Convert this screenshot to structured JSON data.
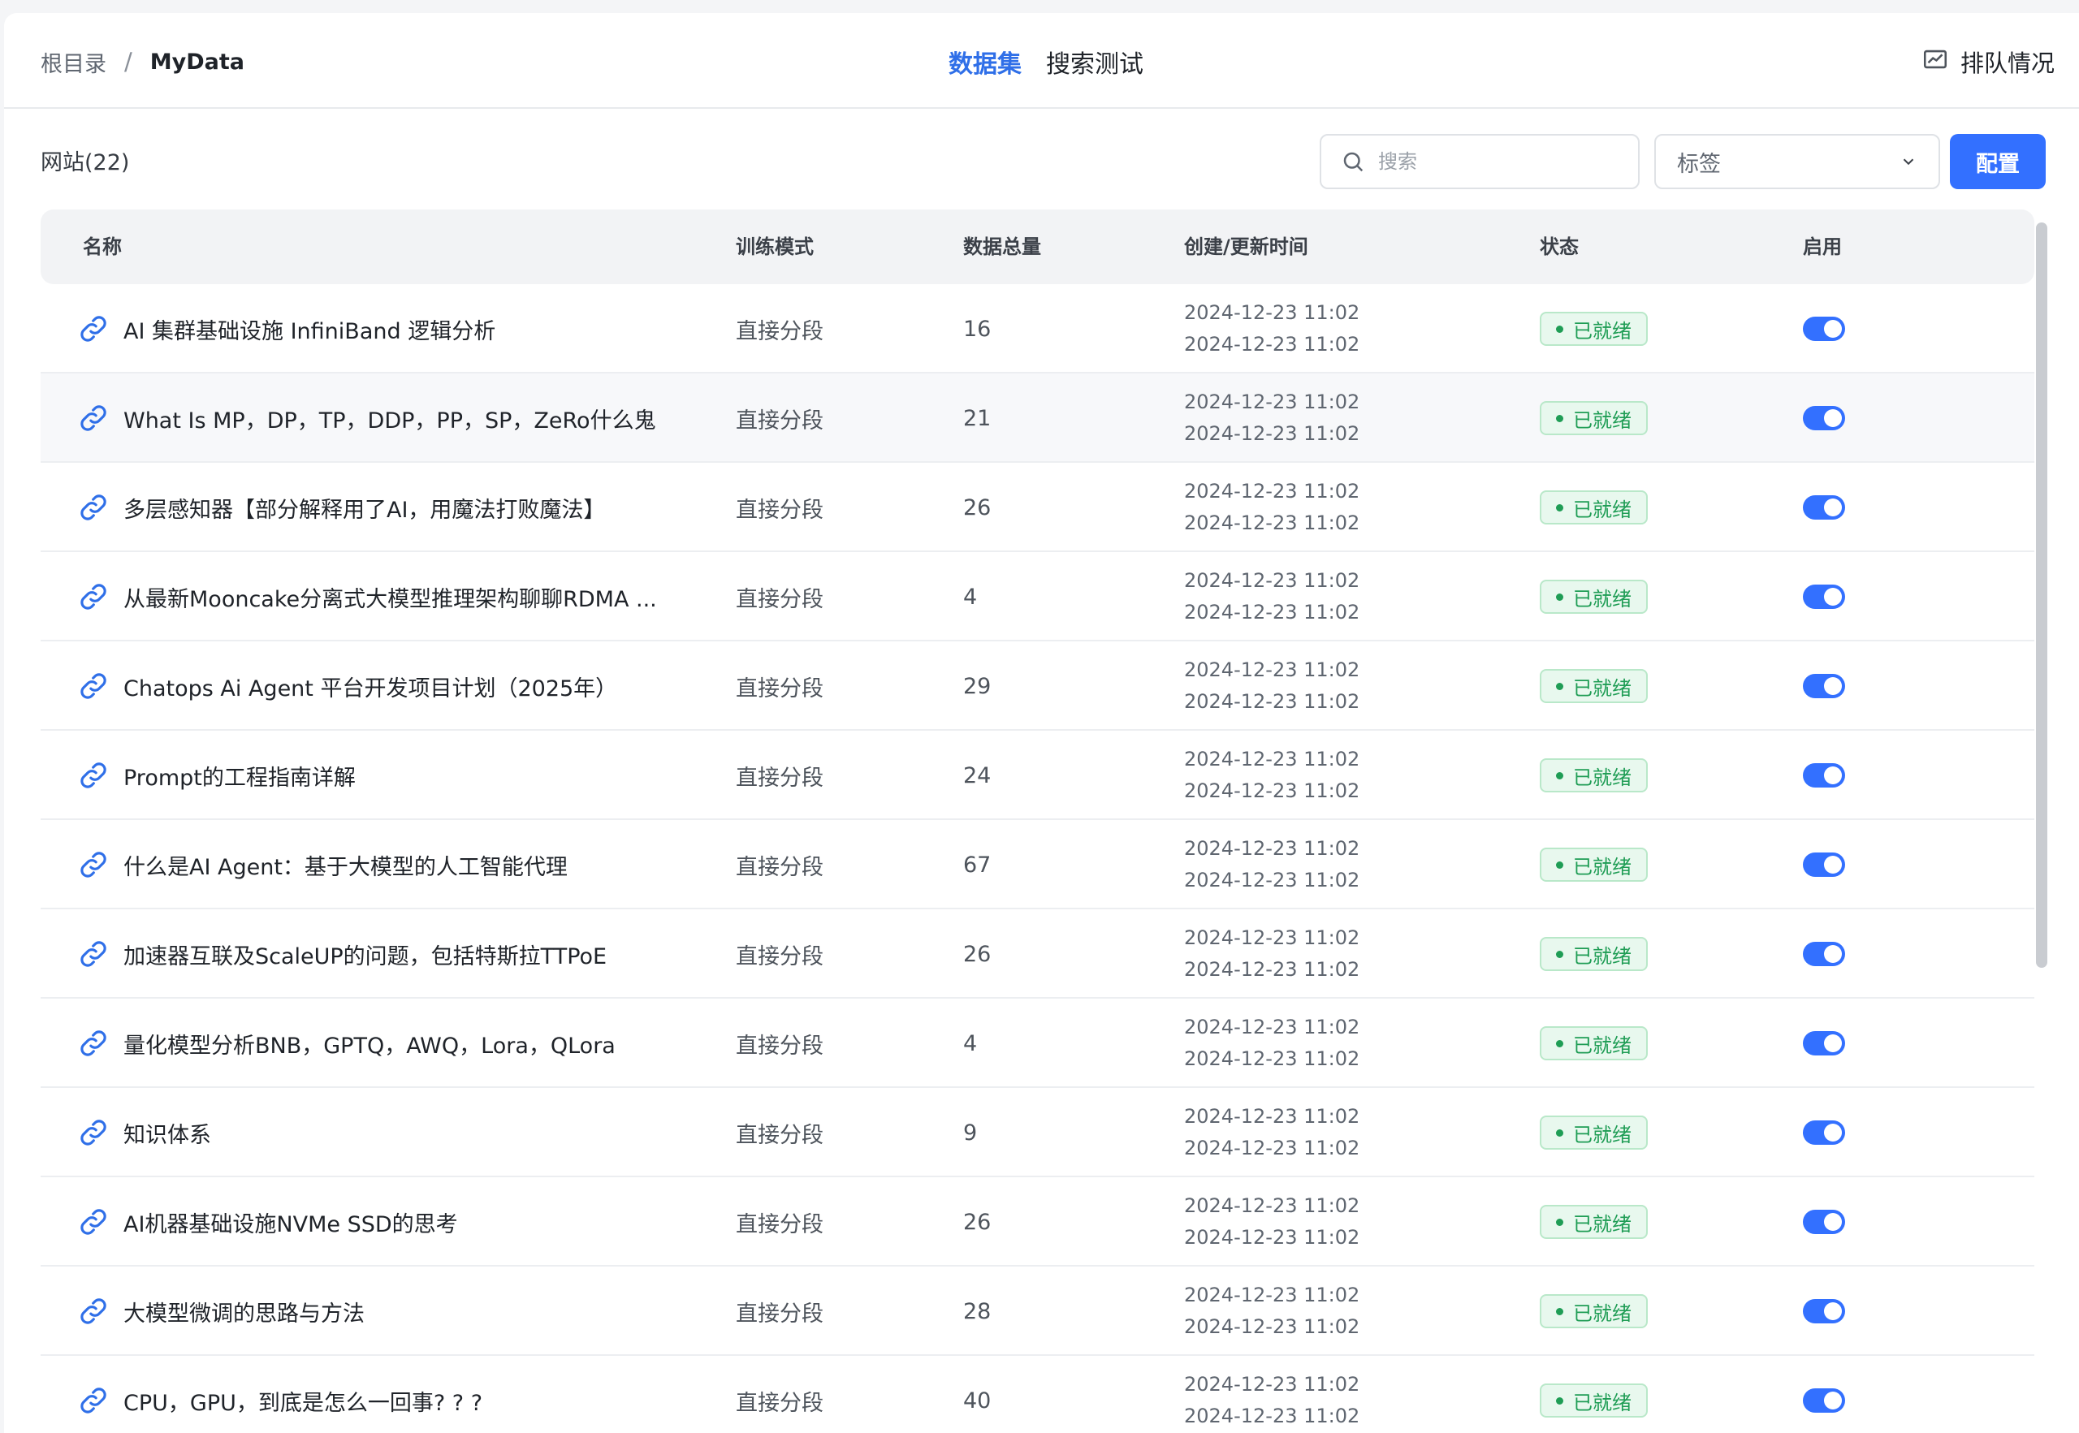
{
  "breadcrumb": {
    "root": "根目录",
    "separator": "/",
    "current": "MyData"
  },
  "tabs": [
    {
      "label": "数据集",
      "active": true
    },
    {
      "label": "搜索测试",
      "active": false
    }
  ],
  "queue": {
    "label": "排队情况",
    "icon": "queue-chart-icon"
  },
  "toolbar": {
    "count_label": "网站(22)",
    "search_placeholder": "搜索",
    "tag_select_label": "标签",
    "config_button": "配置"
  },
  "table": {
    "columns": [
      "名称",
      "训练模式",
      "数据总量",
      "创建/更新时间",
      "状态",
      "启用"
    ],
    "rows": [
      {
        "name": "AI 集群基础设施 InfiniBand 逻辑分析",
        "mode": "直接分段",
        "count": "16",
        "created": "2024-12-23 11:02",
        "updated": "2024-12-23 11:02",
        "status": "已就绪",
        "enabled": true
      },
      {
        "name": "What Is MP，DP，TP，DDP，PP，SP，ZeRo什么鬼",
        "mode": "直接分段",
        "count": "21",
        "created": "2024-12-23 11:02",
        "updated": "2024-12-23 11:02",
        "status": "已就绪",
        "enabled": true
      },
      {
        "name": "多层感知器【部分解释用了AI，用魔法打败魔法】",
        "mode": "直接分段",
        "count": "26",
        "created": "2024-12-23 11:02",
        "updated": "2024-12-23 11:02",
        "status": "已就绪",
        "enabled": true
      },
      {
        "name": "从最新Mooncake分离式大模型推理架构聊聊RDMA ...",
        "mode": "直接分段",
        "count": "4",
        "created": "2024-12-23 11:02",
        "updated": "2024-12-23 11:02",
        "status": "已就绪",
        "enabled": true
      },
      {
        "name": "Chatops Ai Agent 平台开发项目计划（2025年）",
        "mode": "直接分段",
        "count": "29",
        "created": "2024-12-23 11:02",
        "updated": "2024-12-23 11:02",
        "status": "已就绪",
        "enabled": true
      },
      {
        "name": "Prompt的工程指南详解",
        "mode": "直接分段",
        "count": "24",
        "created": "2024-12-23 11:02",
        "updated": "2024-12-23 11:02",
        "status": "已就绪",
        "enabled": true
      },
      {
        "name": "什么是AI Agent：基于大模型的人工智能代理",
        "mode": "直接分段",
        "count": "67",
        "created": "2024-12-23 11:02",
        "updated": "2024-12-23 11:02",
        "status": "已就绪",
        "enabled": true
      },
      {
        "name": "加速器互联及ScaleUP的问题，包括特斯拉TTPoE",
        "mode": "直接分段",
        "count": "26",
        "created": "2024-12-23 11:02",
        "updated": "2024-12-23 11:02",
        "status": "已就绪",
        "enabled": true
      },
      {
        "name": "量化模型分析BNB，GPTQ，AWQ，Lora，QLora",
        "mode": "直接分段",
        "count": "4",
        "created": "2024-12-23 11:02",
        "updated": "2024-12-23 11:02",
        "status": "已就绪",
        "enabled": true
      },
      {
        "name": "知识体系",
        "mode": "直接分段",
        "count": "9",
        "created": "2024-12-23 11:02",
        "updated": "2024-12-23 11:02",
        "status": "已就绪",
        "enabled": true
      },
      {
        "name": "AI机器基础设施NVMe SSD的思考",
        "mode": "直接分段",
        "count": "26",
        "created": "2024-12-23 11:02",
        "updated": "2024-12-23 11:02",
        "status": "已就绪",
        "enabled": true
      },
      {
        "name": "大模型微调的思路与方法",
        "mode": "直接分段",
        "count": "28",
        "created": "2024-12-23 11:02",
        "updated": "2024-12-23 11:02",
        "status": "已就绪",
        "enabled": true
      },
      {
        "name": "CPU，GPU，到底是怎么一回事? ? ?",
        "mode": "直接分段",
        "count": "40",
        "created": "2024-12-23 11:02",
        "updated": "2024-12-23 11:02",
        "status": "已就绪",
        "enabled": true
      }
    ],
    "hover_row": 1
  },
  "colors": {
    "accent": "#3370ff",
    "active_tab": "#2f6fe8",
    "ready_green": "#1f9d55",
    "ready_bg": "#e8f8ee"
  },
  "icons": {
    "link": "link-icon",
    "search": "search-icon",
    "chevron": "chevron-down-icon"
  }
}
